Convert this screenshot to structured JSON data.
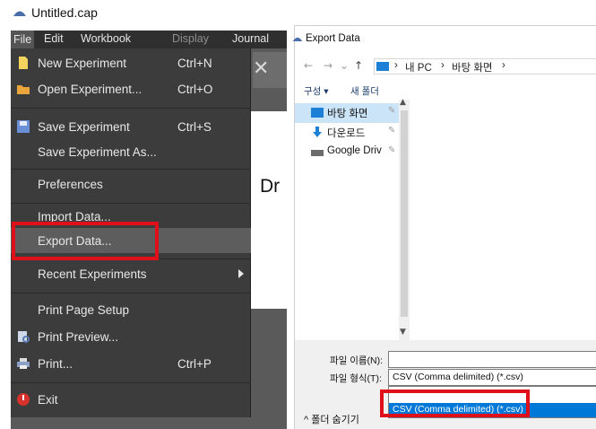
{
  "left_window": {
    "title": "Untitled.cap",
    "menubar": [
      "File",
      "Edit",
      "Workbook",
      "Display",
      "Journal"
    ],
    "canvas_text": "Dr",
    "file_menu": [
      {
        "label": "New Experiment",
        "shortcut": "Ctrl+N",
        "icon": "new-document-icon"
      },
      {
        "label": "Open Experiment...",
        "shortcut": "Ctrl+O",
        "icon": "folder-open-icon"
      },
      {
        "label": "Save Experiment",
        "shortcut": "Ctrl+S",
        "icon": "save-icon"
      },
      {
        "label": "Save Experiment As...",
        "shortcut": "",
        "icon": ""
      },
      {
        "label": "Preferences",
        "shortcut": "",
        "icon": ""
      },
      {
        "label": "Import Data...",
        "shortcut": "",
        "icon": ""
      },
      {
        "label": "Export Data...",
        "shortcut": "",
        "icon": ""
      },
      {
        "label": "Recent Experiments",
        "shortcut": "",
        "icon": "submenu-arrow-icon"
      },
      {
        "label": "Print Page Setup",
        "shortcut": "",
        "icon": ""
      },
      {
        "label": "Print Preview...",
        "shortcut": "",
        "icon": "print-preview-icon"
      },
      {
        "label": "Print...",
        "shortcut": "Ctrl+P",
        "icon": "printer-icon"
      },
      {
        "label": "Exit",
        "shortcut": "",
        "icon": "exit-icon"
      }
    ],
    "highlighted_item": "Export Data..."
  },
  "dialog": {
    "title": "Export Data",
    "nav": {
      "back": "←",
      "forward": "→",
      "dropdown": "⌄",
      "up": "↑"
    },
    "breadcrumb": [
      "내 PC",
      "바탕 화면"
    ],
    "toolbar": {
      "organize": "구성 ▾",
      "new_folder": "새 폴더"
    },
    "nav_pane": [
      {
        "label": "바탕 화면",
        "icon": "desktop-folder-icon",
        "pin": "📌"
      },
      {
        "label": "다운로드",
        "icon": "download-arrow-icon",
        "pin": "📌"
      },
      {
        "label": "Google Driv",
        "icon": "drive-icon",
        "pin": "📌"
      }
    ],
    "filename_label": "파일 이름(N):",
    "filename_value": "",
    "filetype_label": "파일 형식(T):",
    "filetype_value": "CSV (Comma delimited) (*.csv)",
    "filetype_option_selected": "CSV (Comma delimited) (*.csv)",
    "hide_folders": "^ 폴더 숨기기"
  },
  "colors": {
    "highlight_red": "#e0101a",
    "menu_bg": "#3c3c3c",
    "selection_blue": "#0078d7"
  }
}
